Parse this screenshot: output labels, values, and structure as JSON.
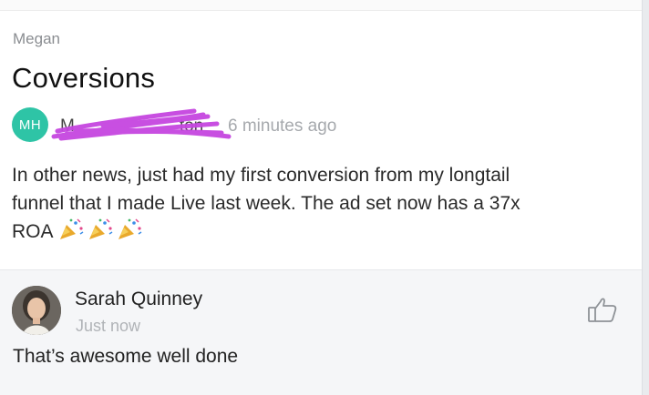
{
  "post": {
    "group": "Megan",
    "title": "Coversions",
    "author": {
      "initials": "MH",
      "name": "M",
      "name_tail": "ton",
      "redaction_color": "#c646e0",
      "avatar_color": "#2ec4a6"
    },
    "time": "6 minutes ago",
    "body_line_1": "In other news, just had my first conversion from my longtail",
    "body_line_2": "funnel that I made Live last week. The ad set now has a 37x",
    "body_line_3": "ROA",
    "emoji_icon": "party-popper-icon"
  },
  "comment": {
    "author": "Sarah Quinney",
    "time": "Just now",
    "text": "That’s awesome well done",
    "like_icon": "thumbs-up-icon"
  }
}
